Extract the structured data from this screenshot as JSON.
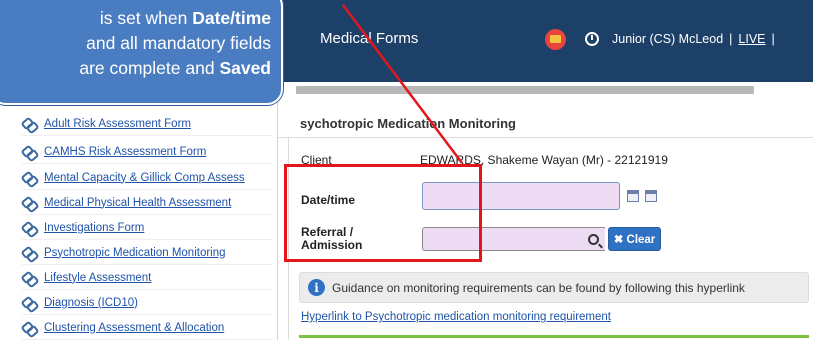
{
  "header": {
    "app_title": "Medical Forms",
    "user": "Junior (CS) McLeod",
    "separator": "|",
    "environment": "LIVE",
    "trailing_separator": "|"
  },
  "sidebar": {
    "items": [
      {
        "label": "Adult Risk Assessment Form"
      },
      {
        "label": "CAMHS Risk Assessment Form"
      },
      {
        "label": "Mental Capacity & Gillick Comp Assess"
      },
      {
        "label": "Medical Physical Health Assessment"
      },
      {
        "label": "Investigations Form"
      },
      {
        "label": "Psychotropic Medication Monitoring"
      },
      {
        "label": "Lifestyle Assessment"
      },
      {
        "label": "Diagnosis (ICD10)"
      },
      {
        "label": "Clustering Assessment & Allocation"
      }
    ]
  },
  "form": {
    "title": "sychotropic Medication Monitoring",
    "client_label": "Client",
    "client_value": "EDWARDS, Shakeme Wayan (Mr) - 22121919",
    "date_label": "Date/time",
    "date_value": "",
    "referral_label_line1": "Referral /",
    "referral_label_line2": "Admission",
    "referral_value": "",
    "clear_label": "✖ Clear",
    "guidance_text": "Guidance on monitoring requirements can be found by following this hyperlink",
    "hyperlink_text": "Hyperlink to Psychotropic medication monitoring requirement"
  },
  "callout": {
    "line1_prefix": "is set when ",
    "line1_bold": "Date/time",
    "line2": "and all mandatory fields",
    "line3_prefix": "are complete and ",
    "line3_bold": "Saved"
  },
  "colors": {
    "header_bg": "#1c4067",
    "callout_bg": "#4a7cc2",
    "highlight": "#e3161b",
    "input_bg": "#eddcf4",
    "clear_button": "#2f72c4",
    "link": "#1f53a8",
    "accent_rule": "#7cc142"
  }
}
